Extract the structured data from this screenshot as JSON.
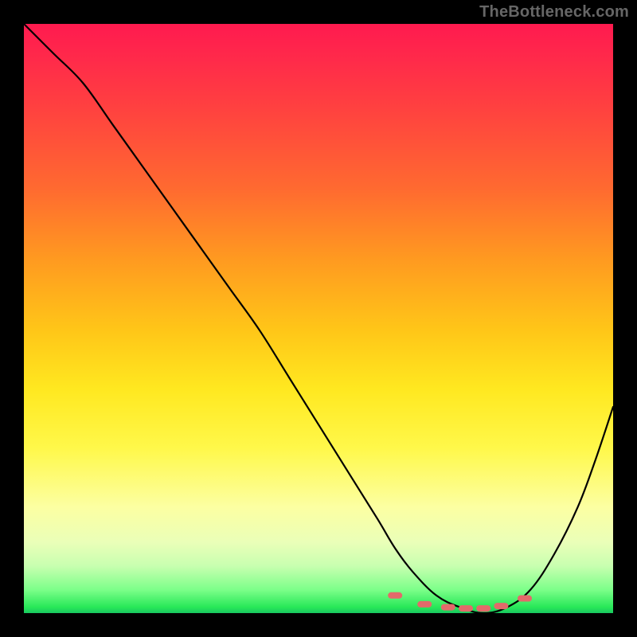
{
  "watermark": "TheBottleneck.com",
  "colors": {
    "background": "#000000",
    "watermark_text": "#666666",
    "curve_stroke": "#000000",
    "marker_fill": "#e36a6a",
    "gradient_stops": [
      "#ff1a4f",
      "#ff4040",
      "#ff9a20",
      "#ffe820",
      "#fcffa2",
      "#c8ffb0",
      "#28e858"
    ]
  },
  "chart_data": {
    "type": "line",
    "title": "",
    "xlabel": "",
    "ylabel": "",
    "xlim": [
      0,
      100
    ],
    "ylim": [
      0,
      100
    ],
    "grid": false,
    "legend": false,
    "annotations": [],
    "series": [
      {
        "name": "bottleneck-curve",
        "x": [
          0,
          5,
          10,
          15,
          20,
          25,
          30,
          35,
          40,
          45,
          50,
          55,
          60,
          63,
          66,
          70,
          74,
          78,
          82,
          86,
          90,
          94,
          97,
          100
        ],
        "values": [
          100,
          95,
          90,
          83,
          76,
          69,
          62,
          55,
          48,
          40,
          32,
          24,
          16,
          11,
          7,
          3,
          1,
          0,
          1,
          4,
          10,
          18,
          26,
          35
        ]
      }
    ],
    "markers": {
      "name": "highlight-dots",
      "style": "pill",
      "color": "#e36a6a",
      "points": [
        {
          "x": 63,
          "y": 3
        },
        {
          "x": 68,
          "y": 1.5
        },
        {
          "x": 72,
          "y": 1
        },
        {
          "x": 75,
          "y": 0.8
        },
        {
          "x": 78,
          "y": 0.8
        },
        {
          "x": 81,
          "y": 1.2
        },
        {
          "x": 85,
          "y": 2.5
        }
      ]
    }
  }
}
